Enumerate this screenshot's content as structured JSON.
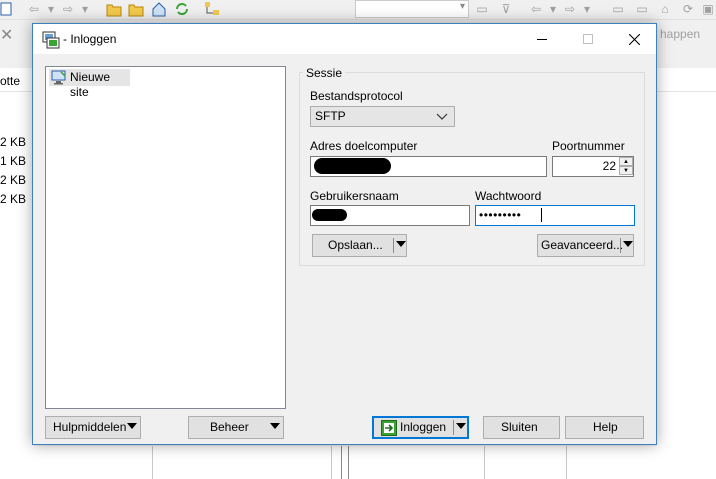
{
  "background": {
    "right_toolbar_text": "happen",
    "left_pane_header": "otte",
    "file_sizes": [
      "2 KB",
      "1 KB",
      "2 KB",
      "2 KB"
    ]
  },
  "dialog": {
    "title": "- Inloggen",
    "site_tree": {
      "items": [
        {
          "label": "Nieuwe site"
        }
      ]
    },
    "session": {
      "legend": "Sessie",
      "protocol_label": "Bestandsprotocol",
      "protocol_value": "SFTP",
      "host_label": "Adres doelcomputer",
      "port_label": "Poortnummer",
      "port_value": "22",
      "user_label": "Gebruikersnaam",
      "password_label": "Wachtwoord",
      "password_value": "•••••••••",
      "save_button": "Opslaan...",
      "advanced_button": "Geavanceerd..."
    },
    "footer": {
      "tools_button": "Hulpmiddelen",
      "manage_button": "Beheer",
      "login_button": "Inloggen",
      "close_button": "Sluiten",
      "help_button": "Help"
    }
  },
  "colors": {
    "accent": "#0078d7",
    "dialog_border": "#3d7fbf",
    "login_icon_green": "#3aa335"
  }
}
